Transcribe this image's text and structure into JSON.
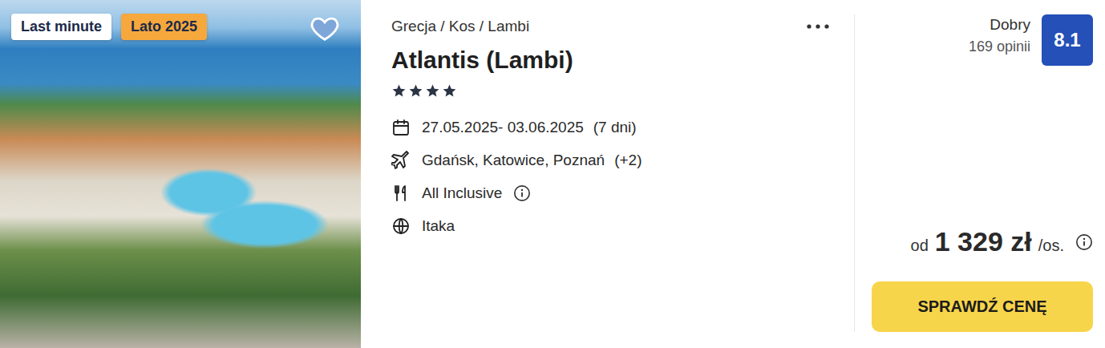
{
  "badges": [
    {
      "label": "Last minute",
      "color": "#ffffff"
    },
    {
      "label": "Lato 2025",
      "color": "#f6a83c"
    }
  ],
  "favorite": false,
  "breadcrumb": "Grecja / Kos / Lambi",
  "title": "Atlantis (Lambi)",
  "stars": 4,
  "details": [
    {
      "kind": "calendar",
      "text": "27.05.2025- 03.06.2025",
      "extra": "(7 dni)",
      "info": false
    },
    {
      "kind": "plane",
      "text": "Gdańsk, Katowice, Poznań",
      "extra": "(+2)",
      "info": false
    },
    {
      "kind": "meal",
      "text": "All Inclusive",
      "extra": "",
      "info": true
    },
    {
      "kind": "globe",
      "text": "Itaka",
      "extra": "",
      "info": false
    }
  ],
  "rating": {
    "label": "Dobry",
    "reviews": "169 opinii",
    "score": "8.1"
  },
  "price": {
    "prefix": "od",
    "amount": "1 329 zł",
    "suffix": "/os."
  },
  "button": "SPRAWDŹ CENĘ"
}
